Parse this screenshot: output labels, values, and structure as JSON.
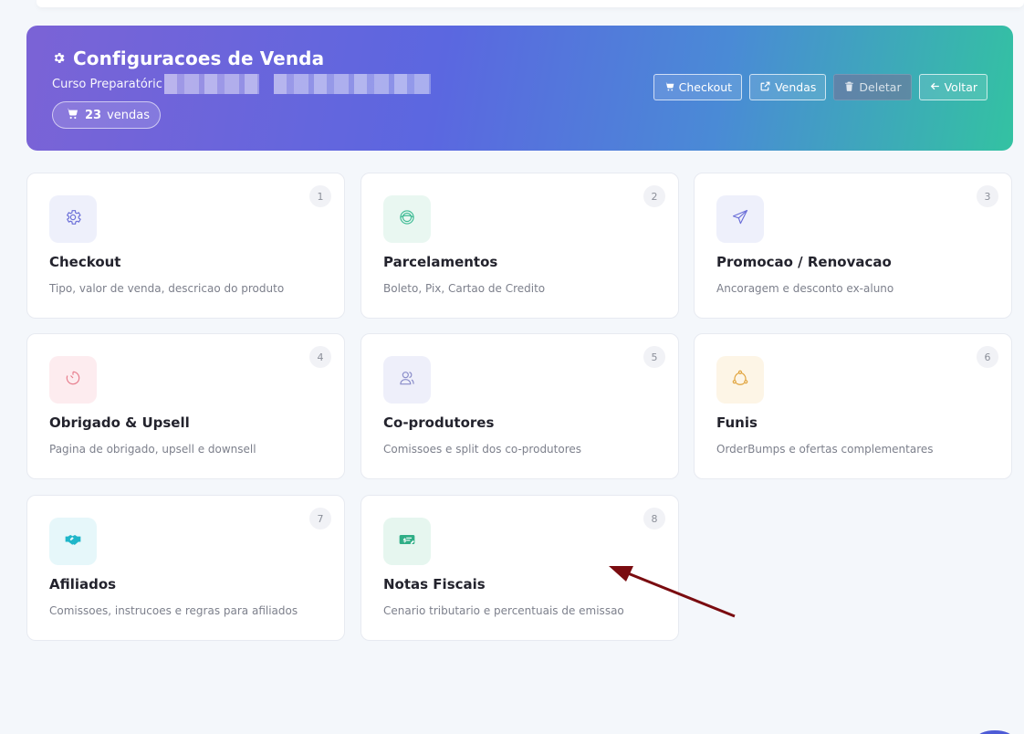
{
  "header": {
    "title": "Configuracoes de Venda",
    "subtitle": "Curso Preparatóric",
    "sales_count": "23",
    "sales_label": "vendas",
    "actions": {
      "checkout": "Checkout",
      "vendas": "Vendas",
      "deletar": "Deletar",
      "voltar": "Voltar"
    }
  },
  "cards": [
    {
      "num": "1",
      "title": "Checkout",
      "desc": "Tipo, valor de venda, descricao do produto",
      "icon": "gear-icon",
      "color": "#6b6fd8",
      "bg": "#eef0fb"
    },
    {
      "num": "2",
      "title": "Parcelamentos",
      "desc": "Boleto, Pix, Cartao de Credito",
      "icon": "coin-icon",
      "color": "#3dbb94",
      "bg": "#e9f7f1"
    },
    {
      "num": "3",
      "title": "Promocao / Renovacao",
      "desc": "Ancoragem e desconto ex-aluno",
      "icon": "paper-plane-icon",
      "color": "#6b6fd8",
      "bg": "#eef0fb"
    },
    {
      "num": "4",
      "title": "Obrigado & Upsell",
      "desc": "Pagina de obrigado, upsell e downsell",
      "icon": "timer-icon",
      "color": "#e77c8c",
      "bg": "#fdecef"
    },
    {
      "num": "5",
      "title": "Co-produtores",
      "desc": "Comissoes e split dos co-produtores",
      "icon": "users-icon",
      "color": "#8a8dc9",
      "bg": "#eeeffa"
    },
    {
      "num": "6",
      "title": "Funis",
      "desc": "OrderBumps e ofertas complementares",
      "icon": "funnel-nodes-icon",
      "color": "#e0a33c",
      "bg": "#fdf5e6"
    },
    {
      "num": "7",
      "title": "Afiliados",
      "desc": "Comissoes, instrucoes e regras para afiliados",
      "icon": "handshake-icon",
      "color": "#1fb6c9",
      "bg": "#e6f7fa"
    },
    {
      "num": "8",
      "title": "Notas Fiscais",
      "desc": "Cenario tributario e percentuais de emissao",
      "icon": "invoice-money-icon",
      "color": "#2fae86",
      "bg": "#e6f6ef"
    }
  ],
  "annotation": {
    "color": "#7a0c10"
  }
}
